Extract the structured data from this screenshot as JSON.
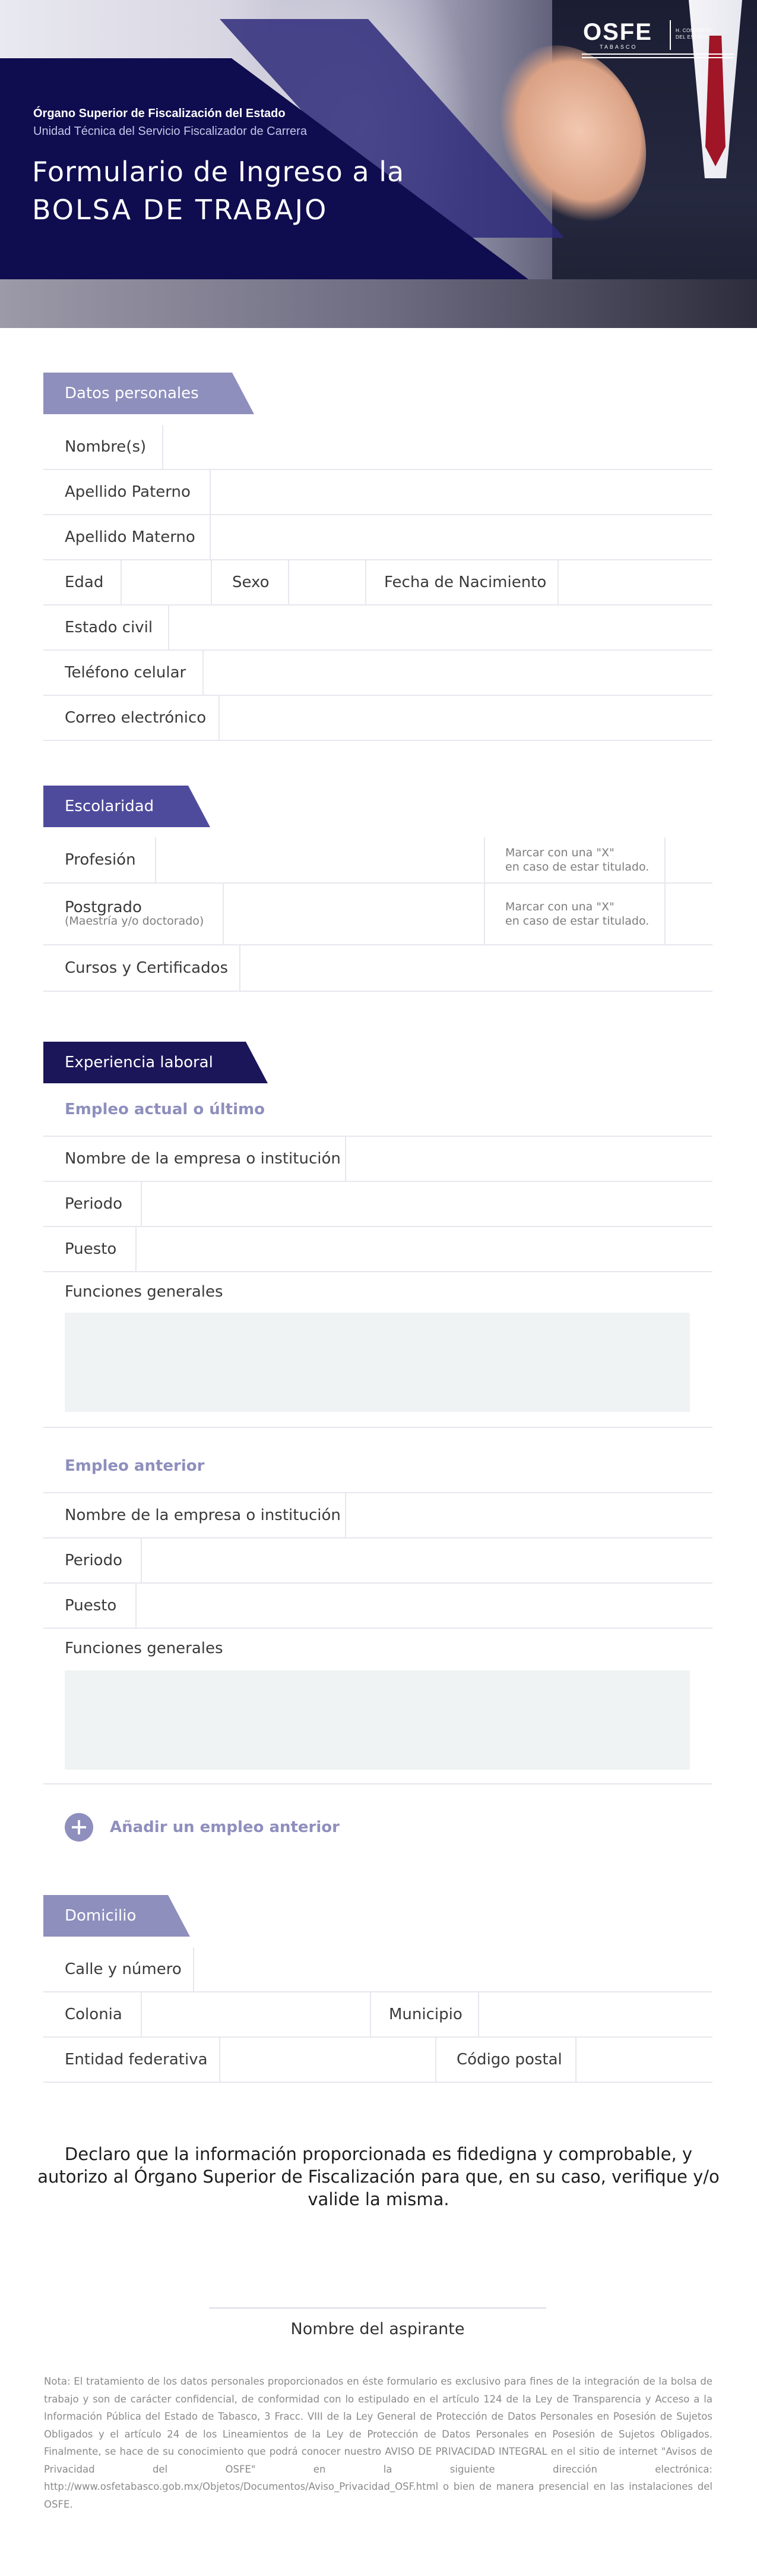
{
  "header": {
    "kicker": "Órgano Superior de Fiscalización del Estado",
    "kicker_sub": "Unidad Técnica del Servicio Fiscalizador de Carrera",
    "title_line1": "Formulario de Ingreso a la",
    "title_line2": "BOLSA DE TRABAJO",
    "logo": {
      "mark": "OSFE",
      "sub": "TABASCO",
      "side_line1": "H. CONGRESO",
      "side_line2": "DEL ESTADO"
    }
  },
  "personal": {
    "tab": "Datos personales",
    "color": "#8e8fbd",
    "fields": {
      "nombre": "Nombre(s)",
      "apellido_paterno": "Apellido Paterno",
      "apellido_materno": "Apellido Materno",
      "edad": "Edad",
      "sexo": "Sexo",
      "fecha_nacimiento": "Fecha de Nacimiento",
      "estado_civil": "Estado civil",
      "telefono": "Teléfono celular",
      "correo": "Correo electrónico"
    }
  },
  "education": {
    "tab": "Escolaridad",
    "color": "#4f4b9c",
    "profesion": "Profesión",
    "postgrado": "Postgrado",
    "postgrado_sub": "(Maestría y/o doctorado)",
    "hint_line1": "Marcar con una \"X\"",
    "hint_line2": "en caso de estar titulado.",
    "cursos": "Cursos y Certificados"
  },
  "experience": {
    "tab": "Experiencia laboral",
    "color": "#1b1559",
    "current": {
      "heading": "Empleo actual o último",
      "empresa": "Nombre de la empresa o institución",
      "periodo": "Periodo",
      "puesto": "Puesto",
      "funciones": "Funciones generales"
    },
    "previous": {
      "heading": "Empleo anterior",
      "empresa": "Nombre de la empresa o institución",
      "periodo": "Periodo",
      "puesto": "Puesto",
      "funciones": "Funciones generales"
    },
    "add_label": "Añadir un empleo anterior"
  },
  "address": {
    "tab": "Domicilio",
    "color": "#8e8fbd",
    "calle": "Calle y número",
    "colonia": "Colonia",
    "municipio": "Municipio",
    "entidad": "Entidad federativa",
    "codigo_postal": "Código postal"
  },
  "declaration": "Declaro que la información proporcionada es fidedigna y comprobable, y autorizo al Órgano Superior de Fiscalización para que, en su caso, verifique y/o valide la misma.",
  "signature_label": "Nombre del aspirante",
  "privacy_note": "Nota: El tratamiento de los datos personales proporcionados en éste formulario es exclusivo para fines de la integración de la bolsa de trabajo y son de carácter confidencial, de conformidad con lo estipulado en el artículo 124 de la Ley de Transparencia y Acceso a la Información Pública del Estado de Tabasco, 3 Fracc. VIII de la Ley General de Protección de Datos Personales en Posesión de Sujetos Obligados y el artículo 24 de los Lineamientos de la Ley de Protección de Datos Personales en Posesión de Sujetos Obligados. Finalmente, se hace de su conocimiento que podrá conocer nuestro AVISO DE PRIVACIDAD INTEGRAL en el sitio de internet \"Avisos de Privacidad del OSFE\" en la siguiente dirección electrónica: http://www.osfetabasco.gob.mx/Objetos/Documentos/Aviso_Privacidad_OSF.html o bien de manera presencial en las instalaciones del OSFE."
}
